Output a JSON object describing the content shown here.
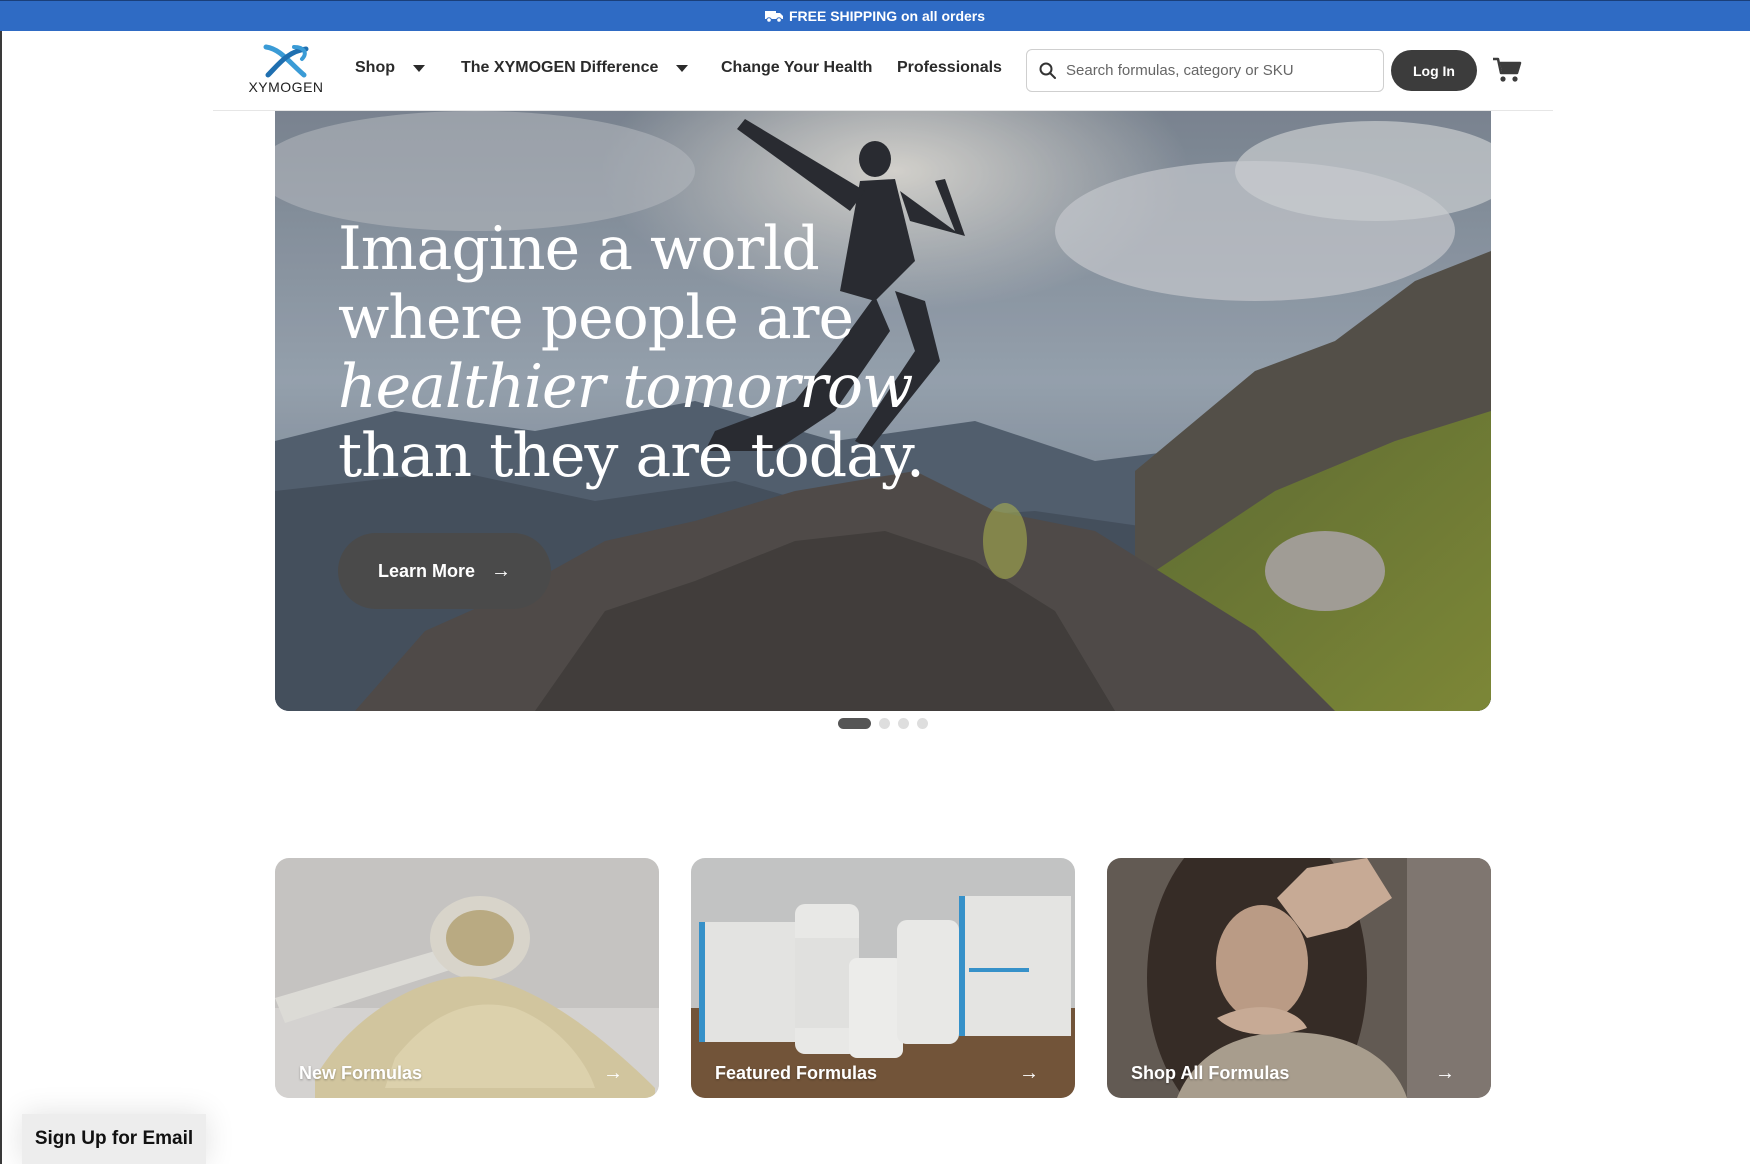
{
  "promo": {
    "text": "FREE SHIPPING on all orders",
    "icon": "truck-icon"
  },
  "header": {
    "logo_text": "XYMOGEN",
    "nav": [
      {
        "label": "Shop",
        "has_dropdown": true
      },
      {
        "label": "The XYMOGEN Difference",
        "has_dropdown": true
      },
      {
        "label": "Change Your Health",
        "has_dropdown": false
      },
      {
        "label": "Professionals",
        "has_dropdown": false
      }
    ],
    "search_placeholder": "Search formulas, category or SKU",
    "login_label": "Log In",
    "cart_icon": "cart-icon"
  },
  "hero": {
    "line1": "Imagine a world",
    "line2": "where people are",
    "line3": "healthier tomorrow",
    "line4": "than they are today.",
    "cta_label": "Learn More",
    "cta_icon": "arrow-right-icon",
    "slide_count": 4,
    "active_slide": 1
  },
  "cards": [
    {
      "label": "New Formulas"
    },
    {
      "label": "Featured Formulas"
    },
    {
      "label": "Shop All Formulas"
    }
  ],
  "email_signup_label": "Sign Up for Email",
  "colors": {
    "promo_bar": "#2f6bc4",
    "button_dark": "#3c3c3c",
    "logo_blue": "#3a9bd6"
  }
}
